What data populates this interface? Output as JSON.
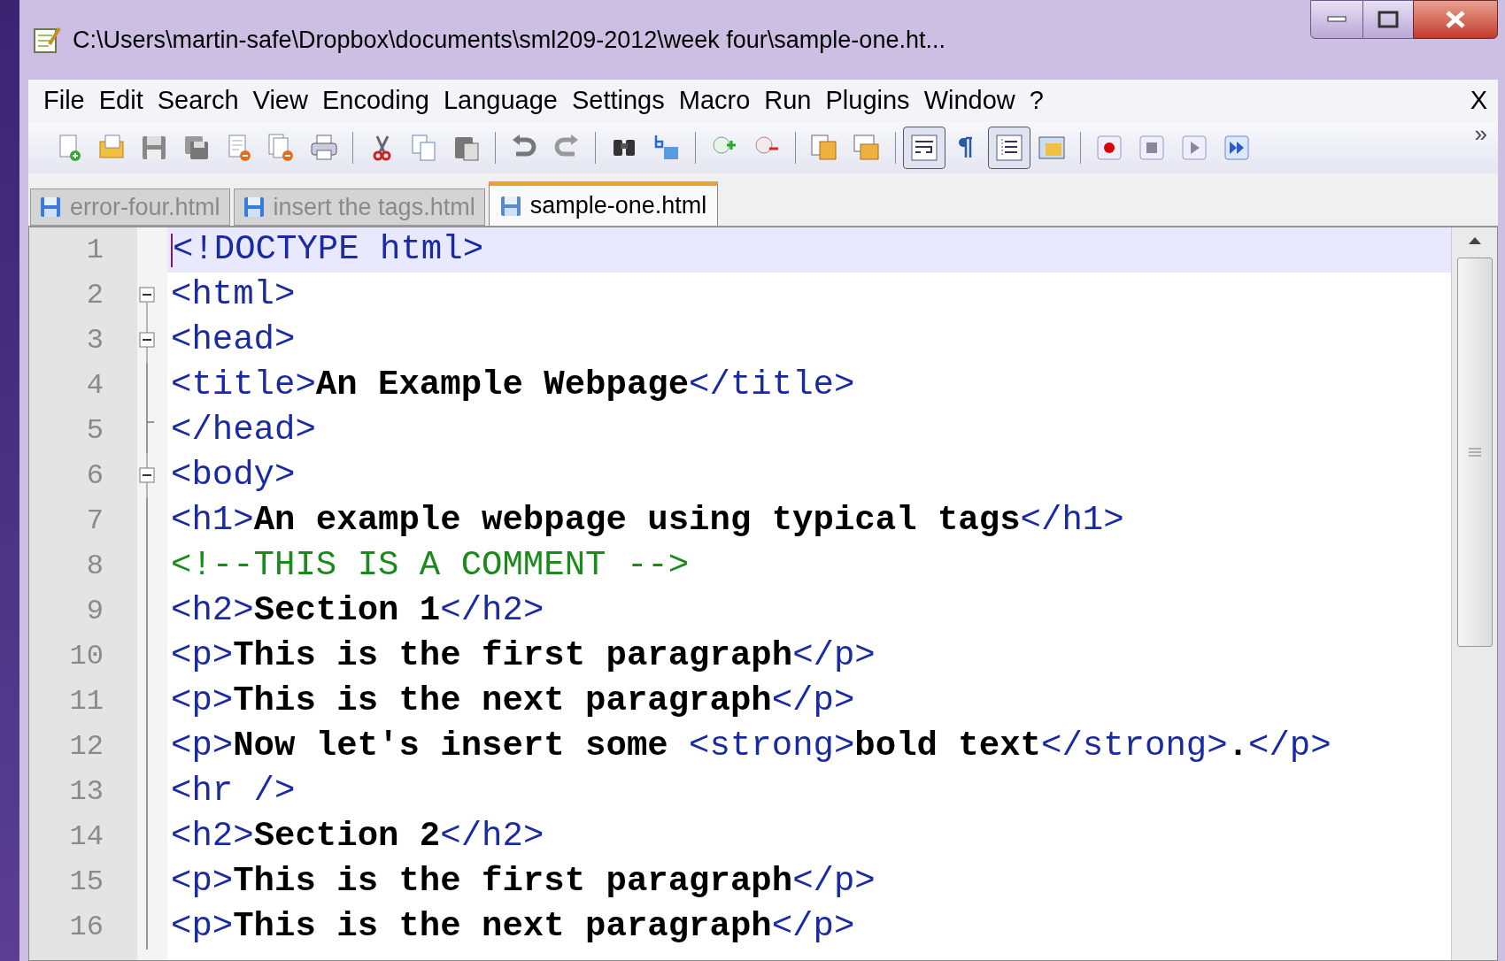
{
  "window": {
    "title": "C:\\Users\\martin-safe\\Dropbox\\documents\\sml209-2012\\week four\\sample-one.ht..."
  },
  "menu": [
    "File",
    "Edit",
    "Search",
    "View",
    "Encoding",
    "Language",
    "Settings",
    "Macro",
    "Run",
    "Plugins",
    "Window",
    "?"
  ],
  "menu_close": "X",
  "toolbar": [
    [
      {
        "kind": "new",
        "pressed": false
      },
      {
        "kind": "open",
        "pressed": false
      },
      {
        "kind": "save",
        "pressed": false
      },
      {
        "kind": "save-all",
        "pressed": false
      },
      {
        "kind": "close",
        "pressed": false
      },
      {
        "kind": "close-all",
        "pressed": false
      },
      {
        "kind": "print",
        "pressed": false
      }
    ],
    [
      {
        "kind": "cut",
        "pressed": false
      },
      {
        "kind": "copy",
        "pressed": false
      },
      {
        "kind": "paste",
        "pressed": false
      }
    ],
    [
      {
        "kind": "undo",
        "pressed": false
      },
      {
        "kind": "redo",
        "pressed": false
      }
    ],
    [
      {
        "kind": "find",
        "pressed": false
      },
      {
        "kind": "replace",
        "pressed": false
      }
    ],
    [
      {
        "kind": "zoom-in",
        "pressed": false
      },
      {
        "kind": "zoom-out",
        "pressed": false
      }
    ],
    [
      {
        "kind": "sync-v",
        "pressed": false
      },
      {
        "kind": "sync-h",
        "pressed": false
      }
    ],
    [
      {
        "kind": "wrap",
        "pressed": true
      },
      {
        "kind": "pilcrow",
        "pressed": false
      },
      {
        "kind": "indent",
        "pressed": true
      },
      {
        "kind": "docmap",
        "pressed": false
      }
    ],
    [
      {
        "kind": "record",
        "pressed": false
      },
      {
        "kind": "stop",
        "pressed": false
      },
      {
        "kind": "play",
        "pressed": false
      },
      {
        "kind": "play-multi",
        "pressed": false
      }
    ]
  ],
  "toolbar_overflow": "»",
  "tabs": [
    {
      "label": "error-four.html",
      "selected": false
    },
    {
      "label": "insert the tags.html",
      "selected": false
    },
    {
      "label": "sample-one.html",
      "selected": true
    }
  ],
  "editor": {
    "lines": [
      {
        "number": "1",
        "kind": "plain",
        "current": true,
        "tokens": [
          {
            "kind": "tag",
            "text": "<!DOCTYPE html>"
          }
        ]
      },
      {
        "number": "2",
        "kind": "fold-start",
        "current": false,
        "tokens": [
          {
            "kind": "tag",
            "text": "<html>"
          }
        ]
      },
      {
        "number": "3",
        "kind": "fold-start",
        "current": false,
        "tokens": [
          {
            "kind": "tag",
            "text": "<head>"
          }
        ]
      },
      {
        "number": "4",
        "kind": "fold-body",
        "current": false,
        "tokens": [
          {
            "kind": "tag",
            "text": "<title>"
          },
          {
            "kind": "text",
            "text": "An Example Webpage"
          },
          {
            "kind": "tag",
            "text": "</title>"
          }
        ]
      },
      {
        "number": "5",
        "kind": "fold-end",
        "current": false,
        "tokens": [
          {
            "kind": "tag",
            "text": "</head>"
          }
        ]
      },
      {
        "number": "6",
        "kind": "fold-start",
        "current": false,
        "tokens": [
          {
            "kind": "tag",
            "text": "<body>"
          }
        ]
      },
      {
        "number": "7",
        "kind": "fold-body",
        "current": false,
        "tokens": [
          {
            "kind": "tag",
            "text": "<h1>"
          },
          {
            "kind": "text",
            "text": "An example webpage using typical tags"
          },
          {
            "kind": "tag",
            "text": "</h1>"
          }
        ]
      },
      {
        "number": "8",
        "kind": "fold-body",
        "current": false,
        "tokens": [
          {
            "kind": "comment",
            "text": "<!--THIS IS A COMMENT -->"
          }
        ]
      },
      {
        "number": "9",
        "kind": "fold-body",
        "current": false,
        "tokens": [
          {
            "kind": "tag",
            "text": "<h2>"
          },
          {
            "kind": "text",
            "text": "Section 1"
          },
          {
            "kind": "tag",
            "text": "</h2>"
          }
        ]
      },
      {
        "number": "10",
        "kind": "fold-body",
        "current": false,
        "tokens": [
          {
            "kind": "tag",
            "text": "<p>"
          },
          {
            "kind": "text",
            "text": "This is the first paragraph"
          },
          {
            "kind": "tag",
            "text": "</p>"
          }
        ]
      },
      {
        "number": "11",
        "kind": "fold-body",
        "current": false,
        "tokens": [
          {
            "kind": "tag",
            "text": "<p>"
          },
          {
            "kind": "text",
            "text": "This is the next paragraph"
          },
          {
            "kind": "tag",
            "text": "</p>"
          }
        ]
      },
      {
        "number": "12",
        "kind": "fold-body",
        "current": false,
        "tokens": [
          {
            "kind": "tag",
            "text": "<p>"
          },
          {
            "kind": "text",
            "text": "Now let's insert some "
          },
          {
            "kind": "tag",
            "text": "<strong>"
          },
          {
            "kind": "text",
            "text": "bold text"
          },
          {
            "kind": "tag",
            "text": "</strong>"
          },
          {
            "kind": "text",
            "text": "."
          },
          {
            "kind": "tag",
            "text": "</p>"
          }
        ]
      },
      {
        "number": "13",
        "kind": "fold-body",
        "current": false,
        "tokens": [
          {
            "kind": "tag",
            "text": "<hr />"
          }
        ]
      },
      {
        "number": "14",
        "kind": "fold-body",
        "current": false,
        "tokens": [
          {
            "kind": "tag",
            "text": "<h2>"
          },
          {
            "kind": "text",
            "text": "Section 2"
          },
          {
            "kind": "tag",
            "text": "</h2>"
          }
        ]
      },
      {
        "number": "15",
        "kind": "fold-body",
        "current": false,
        "tokens": [
          {
            "kind": "tag",
            "text": "<p>"
          },
          {
            "kind": "text",
            "text": "This is the first paragraph"
          },
          {
            "kind": "tag",
            "text": "</p>"
          }
        ]
      },
      {
        "number": "16",
        "kind": "fold-body",
        "current": false,
        "tokens": [
          {
            "kind": "tag",
            "text": "<p>"
          },
          {
            "kind": "text",
            "text": "This is the next paragraph"
          },
          {
            "kind": "tag",
            "text": "</p>"
          }
        ]
      }
    ]
  }
}
